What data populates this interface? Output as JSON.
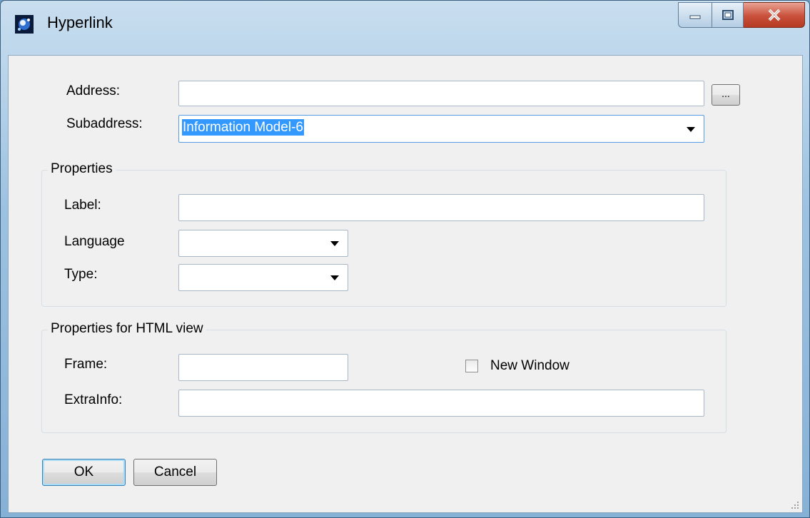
{
  "window": {
    "title": "Hyperlink"
  },
  "fields": {
    "address_label": "Address:",
    "address_value": "",
    "browse_label": "...",
    "subaddress_label": "Subaddress:",
    "subaddress_value": "Information Model-6"
  },
  "properties": {
    "title": "Properties",
    "label_label": "Label:",
    "label_value": "",
    "language_label": "Language",
    "language_value": "",
    "type_label": "Type:",
    "type_value": ""
  },
  "html_view": {
    "title": "Properties for HTML view",
    "frame_label": "Frame:",
    "frame_value": "",
    "new_window_label": "New Window",
    "new_window_checked": false,
    "extrainfo_label": "ExtraInfo:",
    "extrainfo_value": ""
  },
  "buttons": {
    "ok": "OK",
    "cancel": "Cancel"
  }
}
